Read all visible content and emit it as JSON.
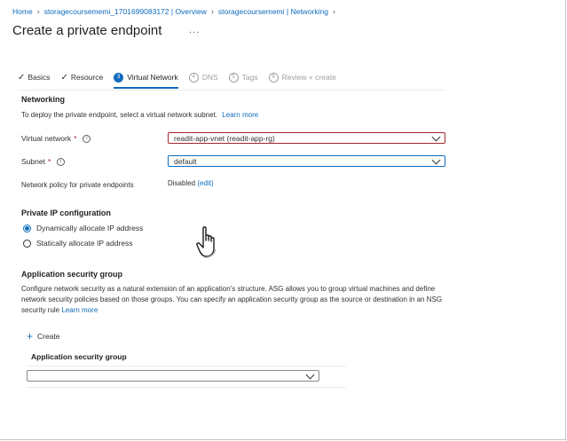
{
  "breadcrumb": [
    "Home",
    "storagecoursememi_1701699083172 | Overview",
    "storagecoursememi | Networking"
  ],
  "page_title": "Create a private endpoint",
  "more_label": "...",
  "tabs": [
    {
      "mark": "✓",
      "label": "Basics",
      "state": "done"
    },
    {
      "mark": "✓",
      "label": "Resource",
      "state": "done"
    },
    {
      "mark": "3",
      "label": "Virtual Network",
      "state": "active"
    },
    {
      "mark": "4",
      "label": "DNS",
      "state": "disabled"
    },
    {
      "mark": "5",
      "label": "Tags",
      "state": "disabled"
    },
    {
      "mark": "6",
      "label": "Review + create",
      "state": "disabled"
    }
  ],
  "networking": {
    "heading": "Networking",
    "description": "To deploy the private endpoint, select a virtual network subnet.",
    "learn_more": "Learn more",
    "vnet_label": "Virtual network",
    "vnet_value": "readit-app-vnet (readit-app-rg)",
    "subnet_label": "Subnet",
    "subnet_value": "default",
    "policy_label": "Network policy for private endpoints",
    "policy_value": "Disabled",
    "policy_edit": "(edit)",
    "required_mark": "*",
    "info_glyph": "i"
  },
  "private_ip": {
    "heading": "Private IP configuration",
    "options": [
      {
        "label": "Dynamically allocate IP address",
        "selected": true
      },
      {
        "label": "Statically allocate IP address",
        "selected": false
      }
    ]
  },
  "asg": {
    "heading": "Application security group",
    "description": "Configure network security as a natural extension of an application's structure. ASG allows you to group virtual machines and define network security policies based on those groups. You can specify an application security group as the source or destination in an NSG security rule",
    "learn_more": "Learn more",
    "create_label": "Create",
    "plus_glyph": "+",
    "column_header": "Application security group",
    "select_value": ""
  },
  "colors": {
    "accent": "#0f6cbd",
    "error": "#a4262c"
  }
}
